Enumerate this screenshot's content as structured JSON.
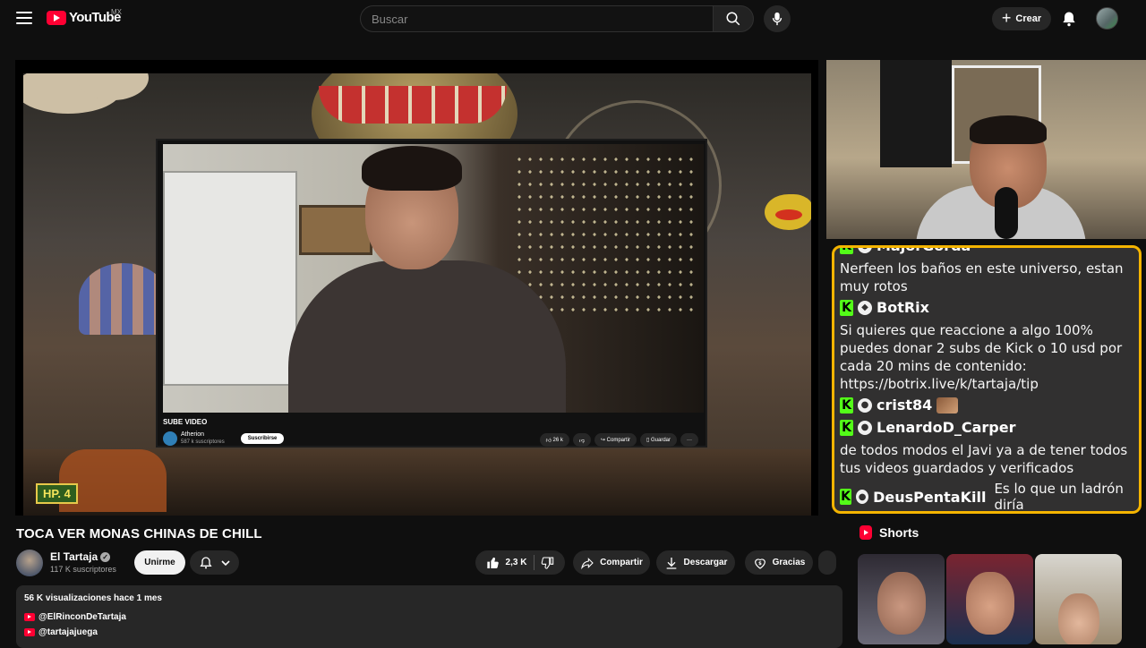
{
  "header": {
    "logo_text": "YouTube",
    "country": "MX",
    "search_placeholder": "Buscar",
    "create_label": "Crear"
  },
  "player": {
    "episode_badge": "HP. 4",
    "inner": {
      "title": "SUBE VIDEO",
      "channel": "Atherion",
      "subs": "587 k suscriptores",
      "subscribe": "Suscribirse",
      "likes": "26 k",
      "share": "Compartir",
      "save": "Guardar"
    }
  },
  "chat": {
    "messages": [
      {
        "user": "MajorGorda",
        "text": "Nerfeen los baños en este universo, estan muy rotos"
      },
      {
        "user": "BotRix",
        "text": "Si quieres que reaccione a algo 100% puedes donar 2 subs de Kick o 10 usd por cada 20 mins de contenido: https://botrix.live/k/tartaja/tip"
      },
      {
        "user": "crist84",
        "text": ""
      },
      {
        "user": "LenardoD_Carper",
        "text": "de todos modos el Javi ya a de tener todos tus videos guardados y verificados"
      },
      {
        "user": "DeusPentaKill",
        "text": "Es lo que un ladrón diría"
      }
    ]
  },
  "video": {
    "title": "TOCA VER MONAS CHINAS DE CHILL",
    "channel_name": "El Tartaja",
    "subscribers": "117 K suscriptores",
    "join_label": "Unirme",
    "likes": "2,3 K",
    "share_label": "Compartir",
    "download_label": "Descargar",
    "thanks_label": "Gracias"
  },
  "description": {
    "stats": "56 K visualizaciones  hace 1 mes",
    "links": [
      "@ElRinconDeTartaja",
      "@tartajajuega"
    ]
  },
  "shorts": {
    "title": "Shorts"
  },
  "colors": {
    "background": "#0f0f0f",
    "youtube_red": "#ff0033",
    "kick_green": "#53fc18",
    "chat_border": "#f4b400"
  }
}
